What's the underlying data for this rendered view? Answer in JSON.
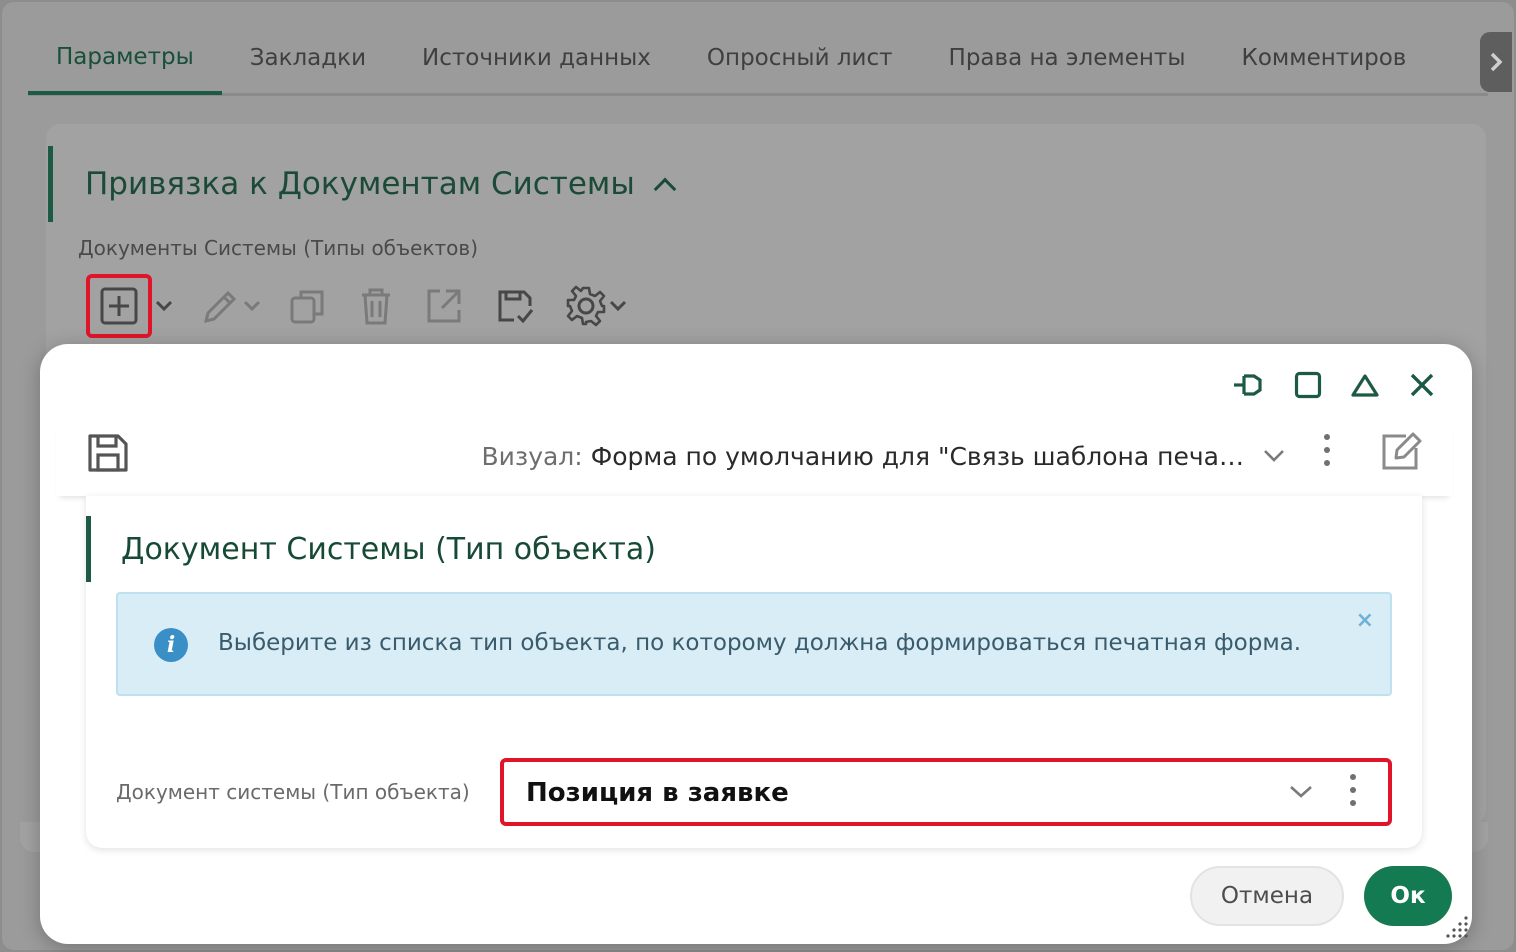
{
  "tabs": [
    {
      "label": "Параметры",
      "active": true
    },
    {
      "label": "Закладки",
      "active": false
    },
    {
      "label": "Источники данных",
      "active": false
    },
    {
      "label": "Опросный лист",
      "active": false
    },
    {
      "label": "Права на элементы",
      "active": false
    },
    {
      "label": "Комментиров",
      "active": false
    }
  ],
  "tabs_scroll_icon": "chevron-right-icon",
  "section": {
    "title": "Привязка к Документам Системы",
    "subtitle": "Документы Системы (Типы объектов)",
    "toolbar_icons": [
      "add-icon",
      "edit-icon",
      "copy-icon",
      "delete-icon",
      "open-external-icon",
      "save-check-icon",
      "settings-icon"
    ]
  },
  "modal": {
    "window_controls": [
      "pin-icon",
      "maximize-icon",
      "collapse-icon",
      "close-icon"
    ],
    "visual_label": "Визуал:",
    "visual_value": "Форма по умолчанию для \"Связь шаблона печа…",
    "card_title": "Документ Системы (Тип объекта)",
    "info_text": "Выберите из списка тип объекта, по которому должна формироваться печатная форма.",
    "info_close": "×",
    "field_label": "Документ системы (Тип объекта)",
    "field_value": "Позиция в заявке",
    "cancel_label": "Отмена",
    "ok_label": "Ок"
  },
  "colors": {
    "accent": "#147a52",
    "title_green": "#174a36",
    "highlight": "#e0152a",
    "info_bg": "#d9edf7"
  }
}
